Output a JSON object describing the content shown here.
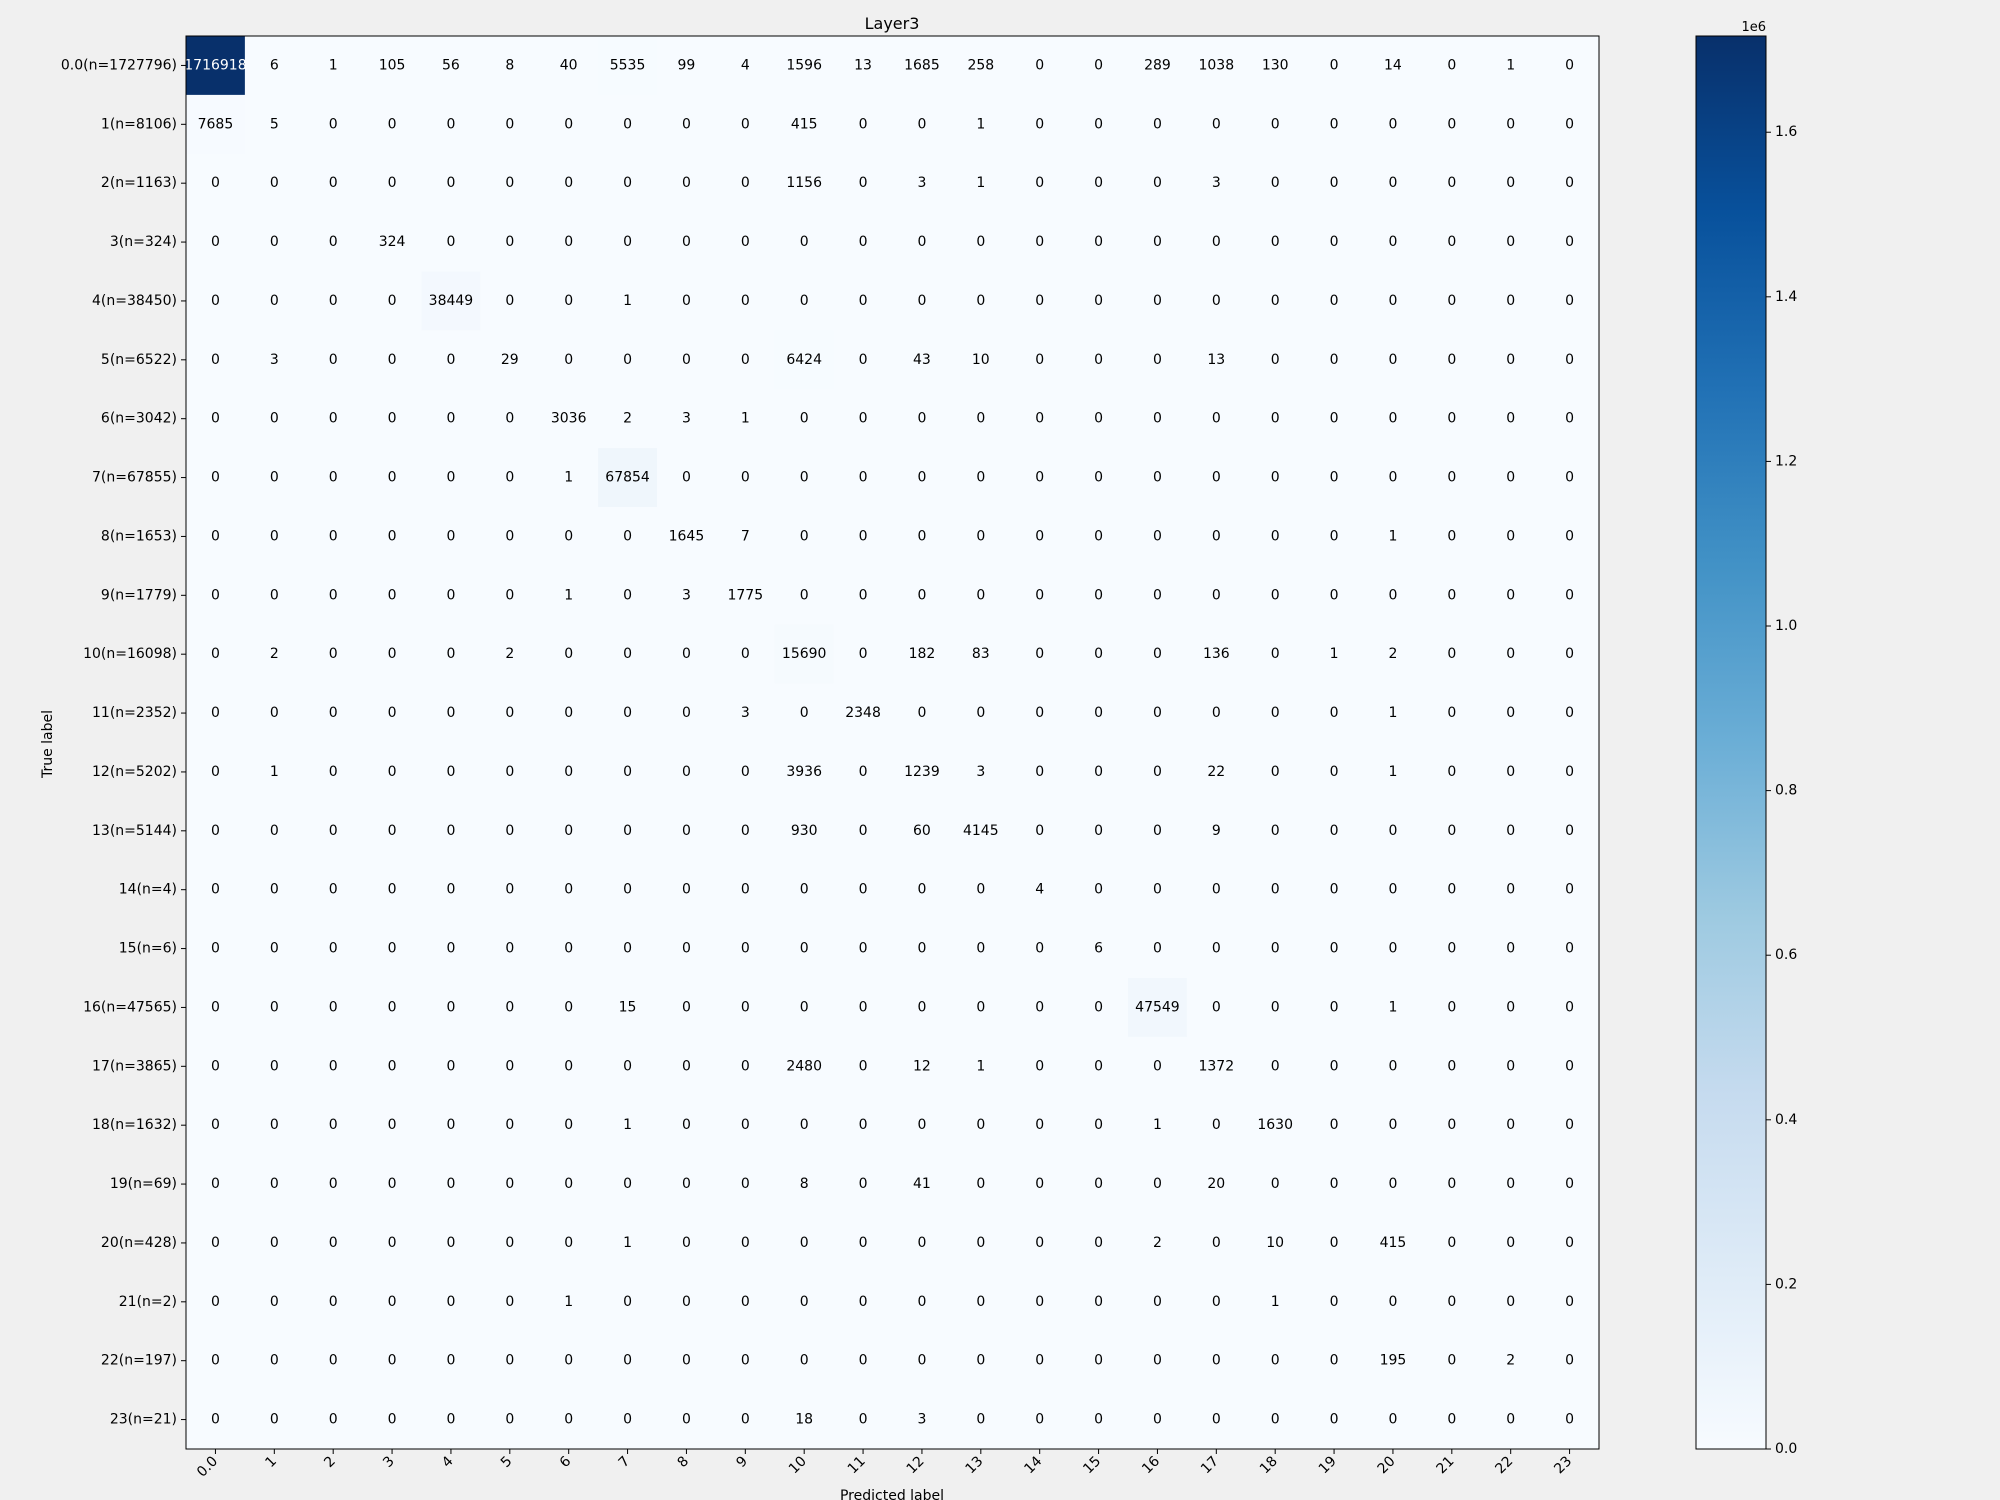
{
  "chart_data": {
    "type": "heatmap",
    "title": "Layer3",
    "xlabel": "Predicted label",
    "ylabel": "True label",
    "x_tick_labels": [
      "0.0",
      "1",
      "2",
      "3",
      "4",
      "5",
      "6",
      "7",
      "8",
      "9",
      "10",
      "11",
      "12",
      "13",
      "14",
      "15",
      "16",
      "17",
      "18",
      "19",
      "20",
      "21",
      "22",
      "23"
    ],
    "y_tick_labels": [
      "0.0(n=1727796)",
      "1(n=8106)",
      "2(n=1163)",
      "3(n=324)",
      "4(n=38450)",
      "5(n=6522)",
      "6(n=3042)",
      "7(n=67855)",
      "8(n=1653)",
      "9(n=1779)",
      "10(n=16098)",
      "11(n=2352)",
      "12(n=5202)",
      "13(n=5144)",
      "14(n=4)",
      "15(n=6)",
      "16(n=47565)",
      "17(n=3865)",
      "18(n=1632)",
      "19(n=69)",
      "20(n=428)",
      "21(n=2)",
      "22(n=197)",
      "23(n=21)"
    ],
    "matrix": [
      [
        1716918,
        6,
        1,
        105,
        56,
        8,
        40,
        5535,
        99,
        4,
        1596,
        13,
        1685,
        258,
        0,
        0,
        289,
        1038,
        130,
        0,
        14,
        0,
        1,
        0
      ],
      [
        7685,
        5,
        0,
        0,
        0,
        0,
        0,
        0,
        0,
        0,
        415,
        0,
        0,
        1,
        0,
        0,
        0,
        0,
        0,
        0,
        0,
        0,
        0,
        0
      ],
      [
        0,
        0,
        0,
        0,
        0,
        0,
        0,
        0,
        0,
        0,
        1156,
        0,
        3,
        1,
        0,
        0,
        0,
        3,
        0,
        0,
        0,
        0,
        0,
        0
      ],
      [
        0,
        0,
        0,
        324,
        0,
        0,
        0,
        0,
        0,
        0,
        0,
        0,
        0,
        0,
        0,
        0,
        0,
        0,
        0,
        0,
        0,
        0,
        0,
        0
      ],
      [
        0,
        0,
        0,
        0,
        38449,
        0,
        0,
        1,
        0,
        0,
        0,
        0,
        0,
        0,
        0,
        0,
        0,
        0,
        0,
        0,
        0,
        0,
        0,
        0
      ],
      [
        0,
        3,
        0,
        0,
        0,
        29,
        0,
        0,
        0,
        0,
        6424,
        0,
        43,
        10,
        0,
        0,
        0,
        13,
        0,
        0,
        0,
        0,
        0,
        0
      ],
      [
        0,
        0,
        0,
        0,
        0,
        0,
        3036,
        2,
        3,
        1,
        0,
        0,
        0,
        0,
        0,
        0,
        0,
        0,
        0,
        0,
        0,
        0,
        0,
        0
      ],
      [
        0,
        0,
        0,
        0,
        0,
        0,
        1,
        67854,
        0,
        0,
        0,
        0,
        0,
        0,
        0,
        0,
        0,
        0,
        0,
        0,
        0,
        0,
        0,
        0
      ],
      [
        0,
        0,
        0,
        0,
        0,
        0,
        0,
        0,
        1645,
        7,
        0,
        0,
        0,
        0,
        0,
        0,
        0,
        0,
        0,
        0,
        1,
        0,
        0,
        0
      ],
      [
        0,
        0,
        0,
        0,
        0,
        0,
        1,
        0,
        3,
        1775,
        0,
        0,
        0,
        0,
        0,
        0,
        0,
        0,
        0,
        0,
        0,
        0,
        0,
        0
      ],
      [
        0,
        2,
        0,
        0,
        0,
        2,
        0,
        0,
        0,
        0,
        15690,
        0,
        182,
        83,
        0,
        0,
        0,
        136,
        0,
        1,
        2,
        0,
        0,
        0
      ],
      [
        0,
        0,
        0,
        0,
        0,
        0,
        0,
        0,
        0,
        3,
        0,
        2348,
        0,
        0,
        0,
        0,
        0,
        0,
        0,
        0,
        1,
        0,
        0,
        0
      ],
      [
        0,
        1,
        0,
        0,
        0,
        0,
        0,
        0,
        0,
        0,
        3936,
        0,
        1239,
        3,
        0,
        0,
        0,
        22,
        0,
        0,
        1,
        0,
        0,
        0
      ],
      [
        0,
        0,
        0,
        0,
        0,
        0,
        0,
        0,
        0,
        0,
        930,
        0,
        60,
        4145,
        0,
        0,
        0,
        9,
        0,
        0,
        0,
        0,
        0,
        0
      ],
      [
        0,
        0,
        0,
        0,
        0,
        0,
        0,
        0,
        0,
        0,
        0,
        0,
        0,
        0,
        4,
        0,
        0,
        0,
        0,
        0,
        0,
        0,
        0,
        0
      ],
      [
        0,
        0,
        0,
        0,
        0,
        0,
        0,
        0,
        0,
        0,
        0,
        0,
        0,
        0,
        0,
        6,
        0,
        0,
        0,
        0,
        0,
        0,
        0,
        0
      ],
      [
        0,
        0,
        0,
        0,
        0,
        0,
        0,
        15,
        0,
        0,
        0,
        0,
        0,
        0,
        0,
        0,
        47549,
        0,
        0,
        0,
        1,
        0,
        0,
        0
      ],
      [
        0,
        0,
        0,
        0,
        0,
        0,
        0,
        0,
        0,
        0,
        2480,
        0,
        12,
        1,
        0,
        0,
        0,
        1372,
        0,
        0,
        0,
        0,
        0,
        0
      ],
      [
        0,
        0,
        0,
        0,
        0,
        0,
        0,
        1,
        0,
        0,
        0,
        0,
        0,
        0,
        0,
        0,
        1,
        0,
        1630,
        0,
        0,
        0,
        0,
        0
      ],
      [
        0,
        0,
        0,
        0,
        0,
        0,
        0,
        0,
        0,
        0,
        8,
        0,
        41,
        0,
        0,
        0,
        0,
        20,
        0,
        0,
        0,
        0,
        0,
        0
      ],
      [
        0,
        0,
        0,
        0,
        0,
        0,
        0,
        1,
        0,
        0,
        0,
        0,
        0,
        0,
        0,
        0,
        2,
        0,
        10,
        0,
        415,
        0,
        0,
        0
      ],
      [
        0,
        0,
        0,
        0,
        0,
        0,
        1,
        0,
        0,
        0,
        0,
        0,
        0,
        0,
        0,
        0,
        0,
        0,
        1,
        0,
        0,
        0,
        0,
        0
      ],
      [
        0,
        0,
        0,
        0,
        0,
        0,
        0,
        0,
        0,
        0,
        0,
        0,
        0,
        0,
        0,
        0,
        0,
        0,
        0,
        0,
        195,
        0,
        2,
        0
      ],
      [
        0,
        0,
        0,
        0,
        0,
        0,
        0,
        0,
        0,
        0,
        18,
        0,
        3,
        0,
        0,
        0,
        0,
        0,
        0,
        0,
        0,
        0,
        0,
        0
      ]
    ],
    "colorbar": {
      "colormap": "Blues",
      "min": 0,
      "max": 1716918,
      "ticks": [
        0.0,
        0.2,
        0.4,
        0.6,
        0.8,
        1.0,
        1.2,
        1.4,
        1.6
      ],
      "tick_labels": [
        "0.0",
        "0.2",
        "0.4",
        "0.6",
        "0.8",
        "1.0",
        "1.2",
        "1.4",
        "1.6"
      ],
      "scale_multiplier": 1000000,
      "offset_text": "1e6"
    },
    "grid": false,
    "colors": {
      "background": "#f0f0f0",
      "cmap_low": "#f7fbff",
      "cmap_high": "#08306b",
      "text_dark": "#000000",
      "text_light": "#ffffff"
    }
  }
}
